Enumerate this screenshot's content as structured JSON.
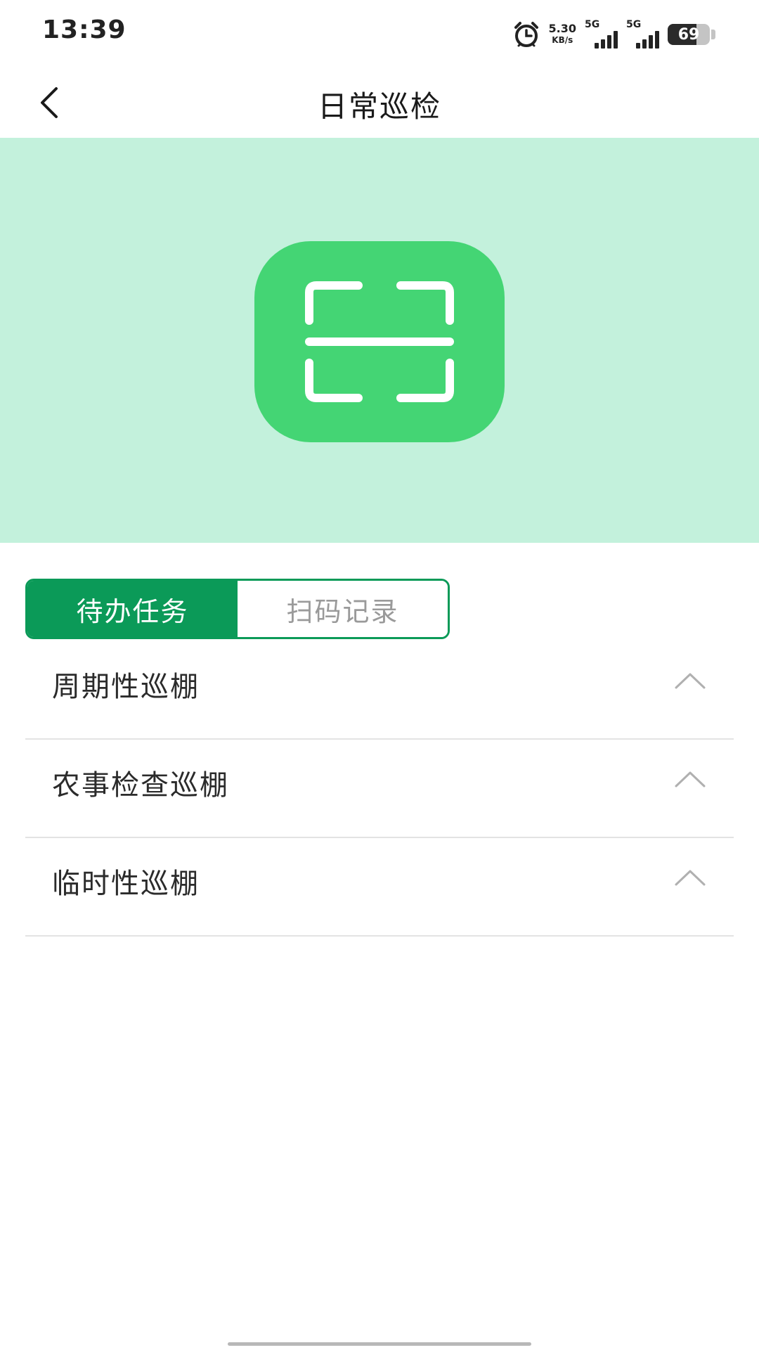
{
  "status_bar": {
    "time": "13:39",
    "net_speed_value": "5.30",
    "net_speed_unit": "KB/s",
    "signal_1_label": "5G",
    "signal_2_label": "5G",
    "battery_level": "69",
    "battery_percent": 69,
    "icons": [
      "alarm-icon",
      "signal-icon",
      "battery-icon"
    ]
  },
  "header": {
    "title": "日常巡检",
    "back_icon": "chevron-left-icon"
  },
  "banner": {
    "background_color": "#c3f1dc",
    "tile_color": "#44d574",
    "icon": "scan-icon"
  },
  "tabs": [
    {
      "label": "待办任务",
      "active": true
    },
    {
      "label": "扫码记录",
      "active": false
    }
  ],
  "tasks": [
    {
      "label": "周期性巡棚",
      "icon": "chevron-up-icon"
    },
    {
      "label": "农事检查巡棚",
      "icon": "chevron-up-icon"
    },
    {
      "label": "临时性巡棚",
      "icon": "chevron-up-icon"
    }
  ],
  "colors": {
    "accent": "#0b9a58",
    "text_primary": "#222222",
    "text_inactive": "#9a9a9a",
    "divider": "#e3e3e3"
  }
}
